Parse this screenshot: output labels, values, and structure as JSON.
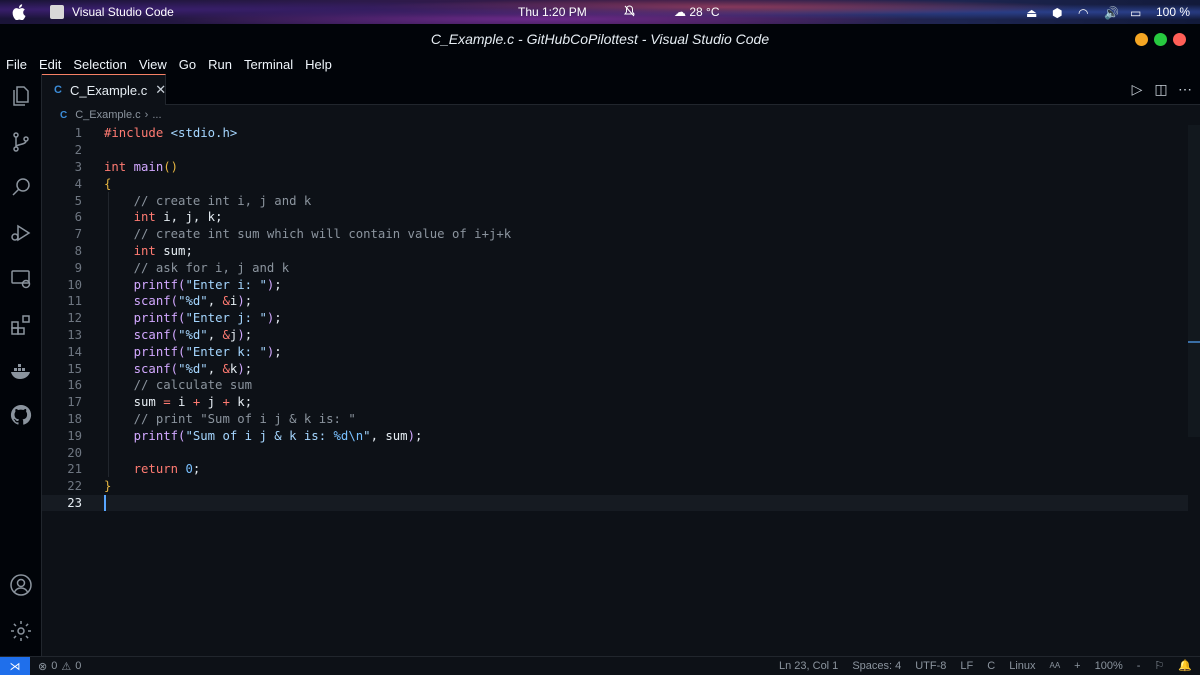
{
  "os": {
    "app_name": "Visual Studio Code",
    "clock": "Thu  1:20 PM",
    "weather": "28 °C",
    "battery": "100 %"
  },
  "window": {
    "title": "C_Example.c - GitHubCoPilottest - Visual Studio Code",
    "traffic_colors": [
      "#f5a623",
      "#27c93f",
      "#ff5f57"
    ]
  },
  "menu": [
    "File",
    "Edit",
    "Selection",
    "View",
    "Go",
    "Run",
    "Terminal",
    "Help"
  ],
  "activity_bar": {
    "top": [
      "explorer-icon",
      "source-control-icon",
      "search-icon",
      "run-debug-icon",
      "remote-explorer-icon",
      "extensions-icon",
      "docker-icon",
      "github-icon"
    ],
    "bottom": [
      "account-icon",
      "settings-gear-icon"
    ]
  },
  "tab": {
    "icon_text": "C",
    "label": "C_Example.c"
  },
  "breadcrumb": {
    "icon_text": "C",
    "file": "C_Example.c",
    "rest": "..."
  },
  "editor": {
    "current_line": 23,
    "lines": [
      "1",
      "2",
      "3",
      "4",
      "5",
      "6",
      "7",
      "8",
      "9",
      "10",
      "11",
      "12",
      "13",
      "14",
      "15",
      "16",
      "17",
      "18",
      "19",
      "20",
      "21",
      "22",
      "23"
    ]
  },
  "status": {
    "errors": "0",
    "warnings": "0",
    "position": "Ln 23, Col 1",
    "spaces": "Spaces: 4",
    "encoding": "UTF-8",
    "eol": "LF",
    "language": "C",
    "platform": "Linux",
    "font_size_indicator": "AA",
    "plus": "+",
    "zoom": "100%",
    "minus": "-"
  },
  "colors": {
    "accent": "#1f6feb",
    "keyword": "#ff7b72",
    "function": "#d2a8ff",
    "string": "#a5d6ff",
    "comment": "#8b949e",
    "number": "#79c0ff"
  }
}
